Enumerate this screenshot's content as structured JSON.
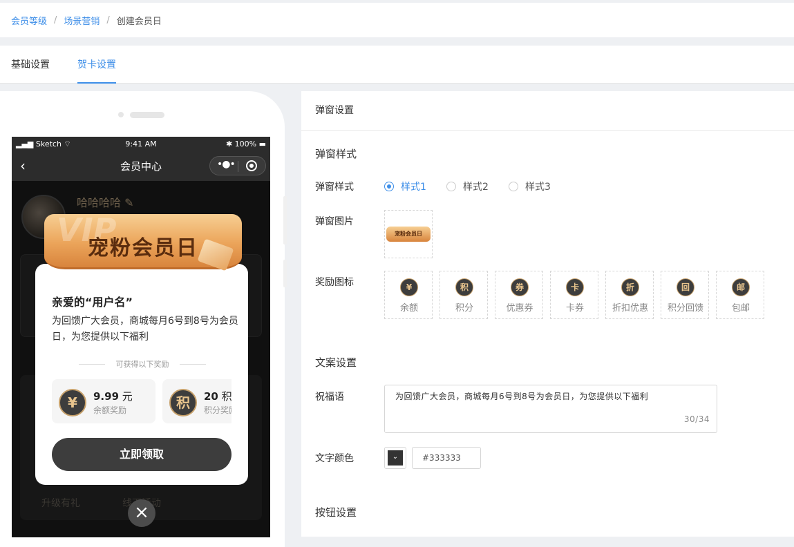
{
  "breadcrumb": {
    "items": [
      "会员等级",
      "场景营销"
    ],
    "current": "创建会员日"
  },
  "tabs": [
    "基础设置",
    "贺卡设置"
  ],
  "phone": {
    "status": {
      "carrier": "Sketch",
      "time": "9:41 AM",
      "battery": "100%"
    },
    "nav_title": "会员中心",
    "user_name": "哈哈哈哈",
    "bg_labels": [
      "升级有礼",
      "线下活动"
    ],
    "popup": {
      "banner_bg_text": "VIP",
      "banner_title": "宠粉会员日",
      "greeting": "亲爱的“用户名”",
      "message": "为回馈广大会员，商城每月6号到8号为会员日，为您提供以下福利",
      "reward_divider": "可获得以下奖励",
      "rewards": [
        {
          "icon": "¥",
          "value": "9.99",
          "unit": "元",
          "desc": "余额奖励"
        },
        {
          "icon": "积",
          "value": "20",
          "unit": "积分",
          "desc": "积分奖励"
        }
      ],
      "claim_button": "立即领取"
    }
  },
  "panel": {
    "header": "弹窗设置",
    "style_section": "弹窗样式",
    "style_label": "弹窗样式",
    "styles": [
      "样式1",
      "样式2",
      "样式3"
    ],
    "selected_style": "样式1",
    "image_label": "弹窗图片",
    "image_thumb_text": "宠粉会员日",
    "icon_label": "奖励图标",
    "icons": [
      {
        "glyph": "¥",
        "label": "余额"
      },
      {
        "glyph": "积",
        "label": "积分"
      },
      {
        "glyph": "券",
        "label": "优惠券"
      },
      {
        "glyph": "卡",
        "label": "卡券"
      },
      {
        "glyph": "折",
        "label": "折扣优惠"
      },
      {
        "glyph": "回",
        "label": "积分回馈"
      },
      {
        "glyph": "邮",
        "label": "包邮"
      }
    ],
    "copy_section": "文案设置",
    "blessing_label": "祝福语",
    "blessing_text": "为回馈广大会员，商城每月6号到8号为会员日，为您提供以下福利",
    "blessing_count": "30/34",
    "text_color_label": "文字颜色",
    "text_color_value": "#333333",
    "button_section": "按钮设置"
  },
  "colors": {
    "accent": "#3d8ee8",
    "gold": "#c6a06a",
    "dark": "#3d3d3d"
  }
}
